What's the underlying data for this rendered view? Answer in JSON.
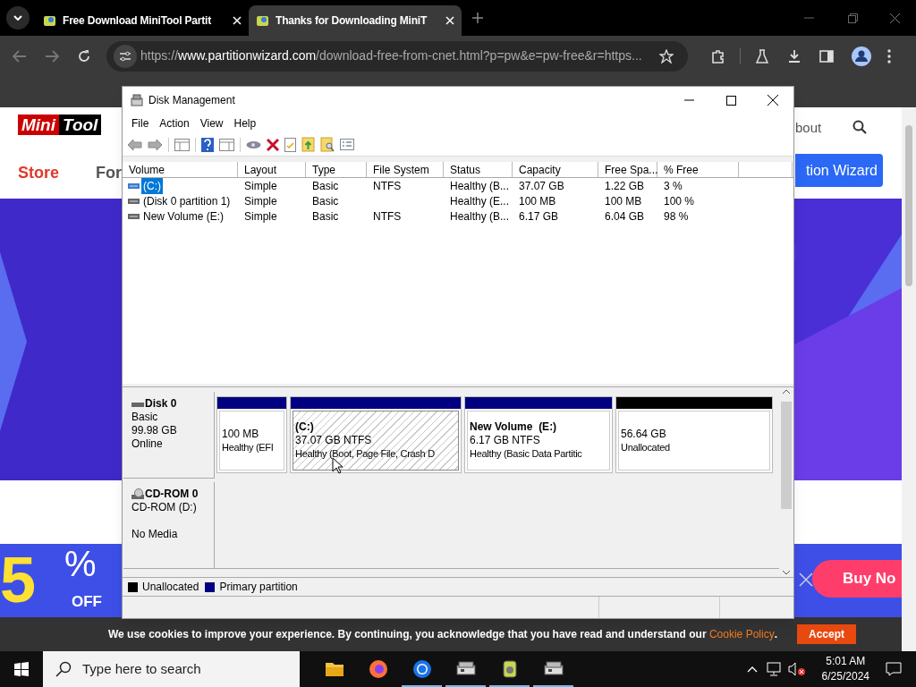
{
  "browser": {
    "tabs": [
      {
        "title": "Free Download MiniTool Partit",
        "selected": false
      },
      {
        "title": "Thanks for Downloading MiniT",
        "selected": true
      }
    ],
    "url": {
      "scheme": "https://",
      "host": "www.partitionwizard.com",
      "rest": "/download-free-from-cnet.html?p=pw&e=pw-free&r=https..."
    }
  },
  "webpage": {
    "logo": [
      "Mini",
      "Tool"
    ],
    "nav": [
      "Store",
      "For",
      "bout"
    ],
    "cta": "tion Wizard",
    "ad": {
      "big": "5",
      "percent": "%",
      "off": "OFF",
      "buy": "Buy No"
    },
    "cookie": {
      "text": "We use cookies to improve your experience. By continuing, you acknowledge that you have read and understand our",
      "link": "Cookie Policy",
      "period": ".",
      "button": "Accept"
    }
  },
  "window": {
    "title": "Disk Management",
    "menu": [
      "File",
      "Action",
      "View",
      "Help"
    ],
    "columns": [
      "Volume",
      "Layout",
      "Type",
      "File System",
      "Status",
      "Capacity",
      "Free Spa...",
      "% Free"
    ],
    "rows": [
      {
        "cells": [
          "(C:)",
          "Simple",
          "Basic",
          "NTFS",
          "Healthy (B...",
          "37.07 GB",
          "1.22 GB",
          "3 %"
        ],
        "selected": true
      },
      {
        "cells": [
          "(Disk 0 partition 1)",
          "Simple",
          "Basic",
          "",
          "Healthy (E...",
          "100 MB",
          "100 MB",
          "100 %"
        ],
        "selected": false
      },
      {
        "cells": [
          "New Volume (E:)",
          "Simple",
          "Basic",
          "NTFS",
          "Healthy (B...",
          "6.17 GB",
          "6.04 GB",
          "98 %"
        ],
        "selected": false
      }
    ],
    "disks": [
      {
        "kind": "disk",
        "name": "Disk 0",
        "lines": [
          "Basic",
          "99.98 GB",
          "Online"
        ],
        "partitions": [
          {
            "kind": "primary",
            "size": "100 MB",
            "status": "Healthy (EFI",
            "selected": false
          },
          {
            "kind": "primary",
            "label": "(C:)",
            "size": "37.07 GB NTFS",
            "status": "Healthy (Boot, Page File, Crash D",
            "selected": true
          },
          {
            "kind": "primary",
            "label": "New Volume  (E:)",
            "size": "6.17 GB NTFS",
            "status": "Healthy (Basic Data Partitic",
            "selected": false
          },
          {
            "kind": "unallocated",
            "size": "56.64 GB",
            "status": "Unallocated",
            "selected": false
          }
        ]
      },
      {
        "kind": "cdrom",
        "name": "CD-ROM 0",
        "lines": [
          "CD-ROM (D:)",
          "No Media"
        ]
      }
    ],
    "legend": [
      {
        "label": "Unallocated",
        "color": "#000000"
      },
      {
        "label": "Primary partition",
        "color": "#000080"
      }
    ]
  },
  "taskbar": {
    "search": "Type here to search",
    "time": "5:01 AM",
    "date": "6/25/2024"
  }
}
